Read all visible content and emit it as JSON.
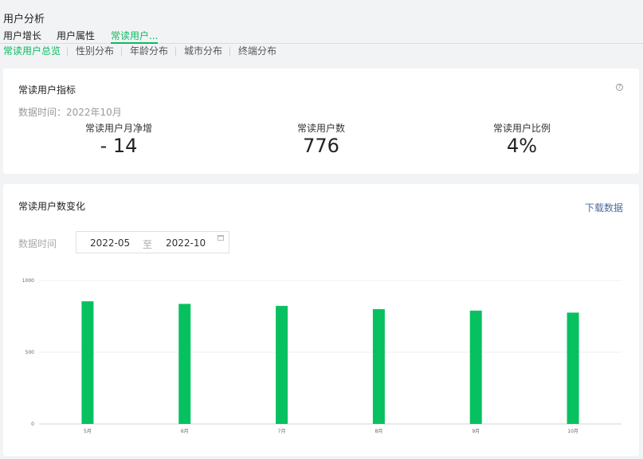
{
  "page": {
    "title": "用户分析"
  },
  "tabs": [
    {
      "label": "用户增长",
      "active": false
    },
    {
      "label": "用户属性",
      "active": false
    },
    {
      "label": "常读用户...",
      "active": true
    }
  ],
  "subtabs": [
    {
      "label": "常读用户总览",
      "active": true
    },
    {
      "label": "性别分布",
      "active": false
    },
    {
      "label": "年龄分布",
      "active": false
    },
    {
      "label": "城市分布",
      "active": false
    },
    {
      "label": "终端分布",
      "active": false
    }
  ],
  "metrics_card": {
    "title": "常读用户指标",
    "help_icon": "question-circle-icon",
    "data_time": "数据时间：2022年10月",
    "metrics": [
      {
        "label": "常读用户月净增",
        "value": "- 14"
      },
      {
        "label": "常读用户数",
        "value": "776"
      },
      {
        "label": "常读用户比例",
        "value": "4%"
      }
    ]
  },
  "trend_card": {
    "title": "常读用户数变化",
    "download_label": "下载数据",
    "filter_label": "数据时间",
    "range_start": "2022-05",
    "range_sep": "至",
    "range_end": "2022-10",
    "calendar_icon": "calendar-icon"
  },
  "chart_data": {
    "type": "bar",
    "categories": [
      "5月",
      "6月",
      "7月",
      "8月",
      "9月",
      "10月"
    ],
    "values": [
      855,
      837,
      823,
      800,
      790,
      776
    ],
    "ylim": [
      0,
      1000
    ],
    "yticks": [
      "0",
      "500",
      "1000"
    ],
    "grid": true,
    "bar_color": "#07c160"
  },
  "colors": {
    "accent": "#09bb5f",
    "link": "#4a6c9b"
  }
}
